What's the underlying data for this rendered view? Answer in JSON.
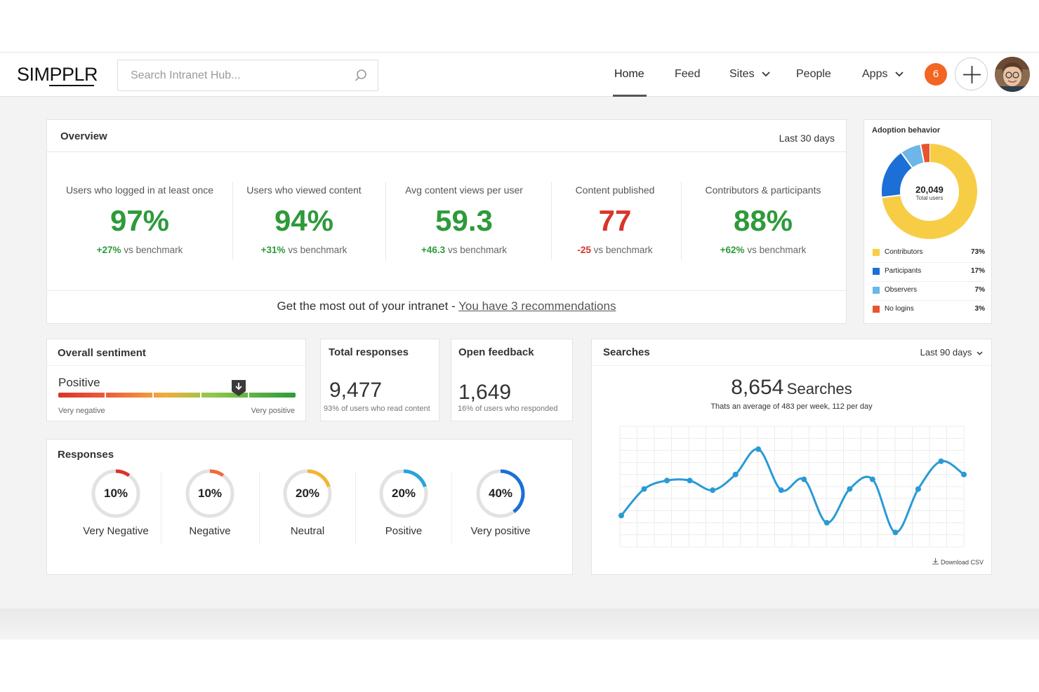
{
  "header": {
    "logo": "SIMPPLR",
    "search_placeholder": "Search Intranet Hub...",
    "nav": [
      {
        "label": "Home",
        "active": true
      },
      {
        "label": "Feed"
      },
      {
        "label": "Sites",
        "dropdown": true
      },
      {
        "label": "People"
      },
      {
        "label": "Apps",
        "dropdown": true
      }
    ],
    "notification_count": "6",
    "icons": {
      "search": "search-icon",
      "add": "plus-icon",
      "avatar": "user-avatar"
    }
  },
  "overview": {
    "title": "Overview",
    "range": "Last 30 days",
    "metrics": [
      {
        "label": "Users who logged in at least once",
        "value": "97%",
        "delta": "+27%",
        "suffix": "vs benchmark",
        "color": "#2e9a3a"
      },
      {
        "label": "Users who viewed content",
        "value": "94%",
        "delta": "+31%",
        "suffix": "vs benchmark",
        "color": "#2e9a3a"
      },
      {
        "label": "Avg content views per user",
        "value": "59.3",
        "delta": "+46.3",
        "suffix": "vs benchmark",
        "color": "#2e9a3a"
      },
      {
        "label": "Content published",
        "value": "77",
        "delta": "-25",
        "suffix": "vs benchmark",
        "color": "#d9342b"
      },
      {
        "label": "Contributors & participants",
        "value": "88%",
        "delta": "+62%",
        "suffix": "vs benchmark",
        "color": "#2e9a3a"
      }
    ],
    "footer_text": "Get the most out of your intranet -",
    "footer_link": "You have 3 recommendations"
  },
  "adoption": {
    "title": "Adoption behavior",
    "total": "20,049",
    "total_label": "Total users",
    "segments": [
      {
        "name": "Contributors",
        "pct": "73%",
        "value": 73,
        "color": "#f7cd46"
      },
      {
        "name": "Participants",
        "pct": "17%",
        "value": 17,
        "color": "#1b6fd6"
      },
      {
        "name": "Observers",
        "pct": "7%",
        "value": 7,
        "color": "#6cb6e8"
      },
      {
        "name": "No logins",
        "pct": "3%",
        "value": 3,
        "color": "#e8542f"
      }
    ]
  },
  "sentiment": {
    "title": "Overall sentiment",
    "value": "Positive",
    "level": 0.76,
    "min_label": "Very negative",
    "max_label": "Very positive"
  },
  "total_responses": {
    "title": "Total responses",
    "value": "9,477",
    "sub": "93% of users who read content"
  },
  "open_feedback": {
    "title": "Open feedback",
    "value": "1,649",
    "sub": "16% of users who responded"
  },
  "responses": {
    "title": "Responses",
    "items": [
      {
        "pct": "10%",
        "value": 10,
        "label": "Very Negative",
        "color": "#d9342b"
      },
      {
        "pct": "10%",
        "value": 10,
        "label": "Negative",
        "color": "#f06a3a"
      },
      {
        "pct": "20%",
        "value": 20,
        "label": "Neutral",
        "color": "#f5b431"
      },
      {
        "pct": "20%",
        "value": 20,
        "label": "Positive",
        "color": "#27a3e0"
      },
      {
        "pct": "40%",
        "value": 40,
        "label": "Very positive",
        "color": "#1b6fd6"
      }
    ]
  },
  "searches": {
    "title": "Searches",
    "range": "Last 90 days",
    "count": "8,654",
    "count_label": "Searches",
    "sub": "Thats an average of 483 per week, 112 per day",
    "download": "Download CSV",
    "line_color": "#2a9ad6"
  },
  "chart_data": {
    "type": "line",
    "title": "",
    "xlabel": "",
    "ylabel": "",
    "grid": true,
    "x": [
      0,
      1,
      2,
      3,
      4,
      5,
      6,
      7,
      8,
      9,
      10,
      11,
      12,
      13,
      14,
      15
    ],
    "ylim": [
      0,
      100
    ],
    "series": [
      {
        "values": [
          26,
          48,
          55,
          55,
          47,
          60,
          81,
          47,
          56,
          20,
          48,
          56,
          12,
          48,
          71,
          60
        ]
      }
    ]
  }
}
